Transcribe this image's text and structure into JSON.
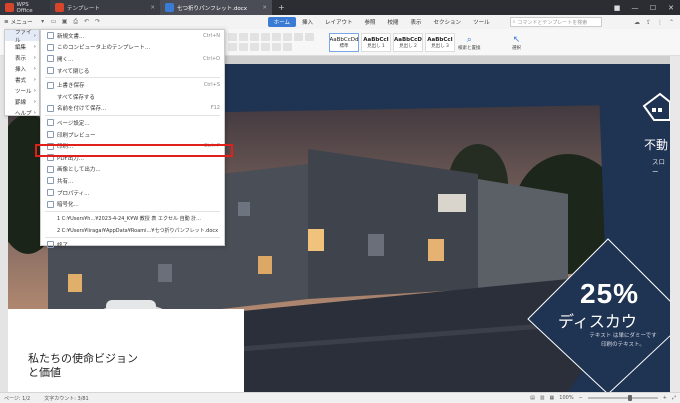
{
  "titlebar": {
    "tabs": [
      {
        "label": "WPS Office"
      },
      {
        "label": "テンプレート"
      },
      {
        "label": "七つ折りパンフレット.docx"
      }
    ],
    "new_tab": "+"
  },
  "menubar": {
    "menu_label": "メニュー",
    "tabs": [
      "ホーム",
      "挿入",
      "レイアウト",
      "参照",
      "校閲",
      "表示",
      "セクション",
      "ツール"
    ],
    "active_tab": "ホーム",
    "search_placeholder": "コマンドとテンプレートを検索"
  },
  "ribbon": {
    "styles": [
      {
        "sample": "AaBbCcDd",
        "name": "標準"
      },
      {
        "sample": "AaBbCcI",
        "name": "見出し 1"
      },
      {
        "sample": "AaBbCcD",
        "name": "見出し 2"
      },
      {
        "sample": "AaBbCcI",
        "name": "見出し 3"
      }
    ],
    "find_replace": "検索と置換",
    "select": "選択"
  },
  "main_menu": {
    "items": [
      {
        "label": "ファイル",
        "submenu": true
      },
      {
        "label": "編集",
        "submenu": true
      },
      {
        "label": "表示",
        "submenu": true
      },
      {
        "label": "挿入",
        "submenu": true
      },
      {
        "label": "書式",
        "submenu": true
      },
      {
        "label": "ツール",
        "submenu": true
      },
      {
        "label": "罫線",
        "submenu": true
      },
      {
        "label": "ヘルプ",
        "submenu": true
      }
    ]
  },
  "file_menu": {
    "items": [
      {
        "label": "新規文書...",
        "shortcut": "Ctrl+N"
      },
      {
        "label": "このコンピュータ上のテンプレート...",
        "shortcut": ""
      },
      {
        "label": "開く...",
        "shortcut": "Ctrl+O"
      },
      {
        "label": "すべて閉じる",
        "shortcut": ""
      },
      {
        "label": "上書き保存",
        "shortcut": "Ctrl+S"
      },
      {
        "label": "すべて保存する",
        "shortcut": ""
      },
      {
        "label": "名前を付けて保存...",
        "shortcut": "F12"
      },
      {
        "label": "ページ設定...",
        "shortcut": ""
      },
      {
        "label": "印刷プレビュー",
        "shortcut": ""
      },
      {
        "label": "印刷...",
        "shortcut": "Ctrl+P"
      },
      {
        "label": "PDF出力...",
        "shortcut": ""
      },
      {
        "label": "画像として出力...",
        "shortcut": ""
      },
      {
        "label": "共有...",
        "shortcut": ""
      },
      {
        "label": "プロパティ...",
        "shortcut": ""
      },
      {
        "label": "暗号化...",
        "shortcut": ""
      }
    ],
    "recent": [
      "1 C:¥Users¥h...¥2023-4-24_K¥W 教授 表 エクセル 自動 計...",
      "2 C:¥Users¥liragai¥AppData¥Roami...¥七つ折りパンフレット.docx"
    ],
    "exit": "終了",
    "highlighted": "PDF出力..."
  },
  "document": {
    "brand_title": "不動",
    "slogan": "スロー",
    "discount_big": "25%",
    "discount_sub": "ディスカウ",
    "discount_small_1": "テキスト は単にダミーです",
    "discount_small_2": "印刷のテキスト。",
    "mission_1": "私たちの使命ビジョン",
    "mission_2": "と価値"
  },
  "statusbar": {
    "page": "ページ: 1/2",
    "words": "文字カウント: 3/81",
    "zoom": "100%"
  },
  "colors": {
    "accent": "#3a7bd5",
    "highlight_box": "#e0211b",
    "navy": "#1f3352"
  }
}
